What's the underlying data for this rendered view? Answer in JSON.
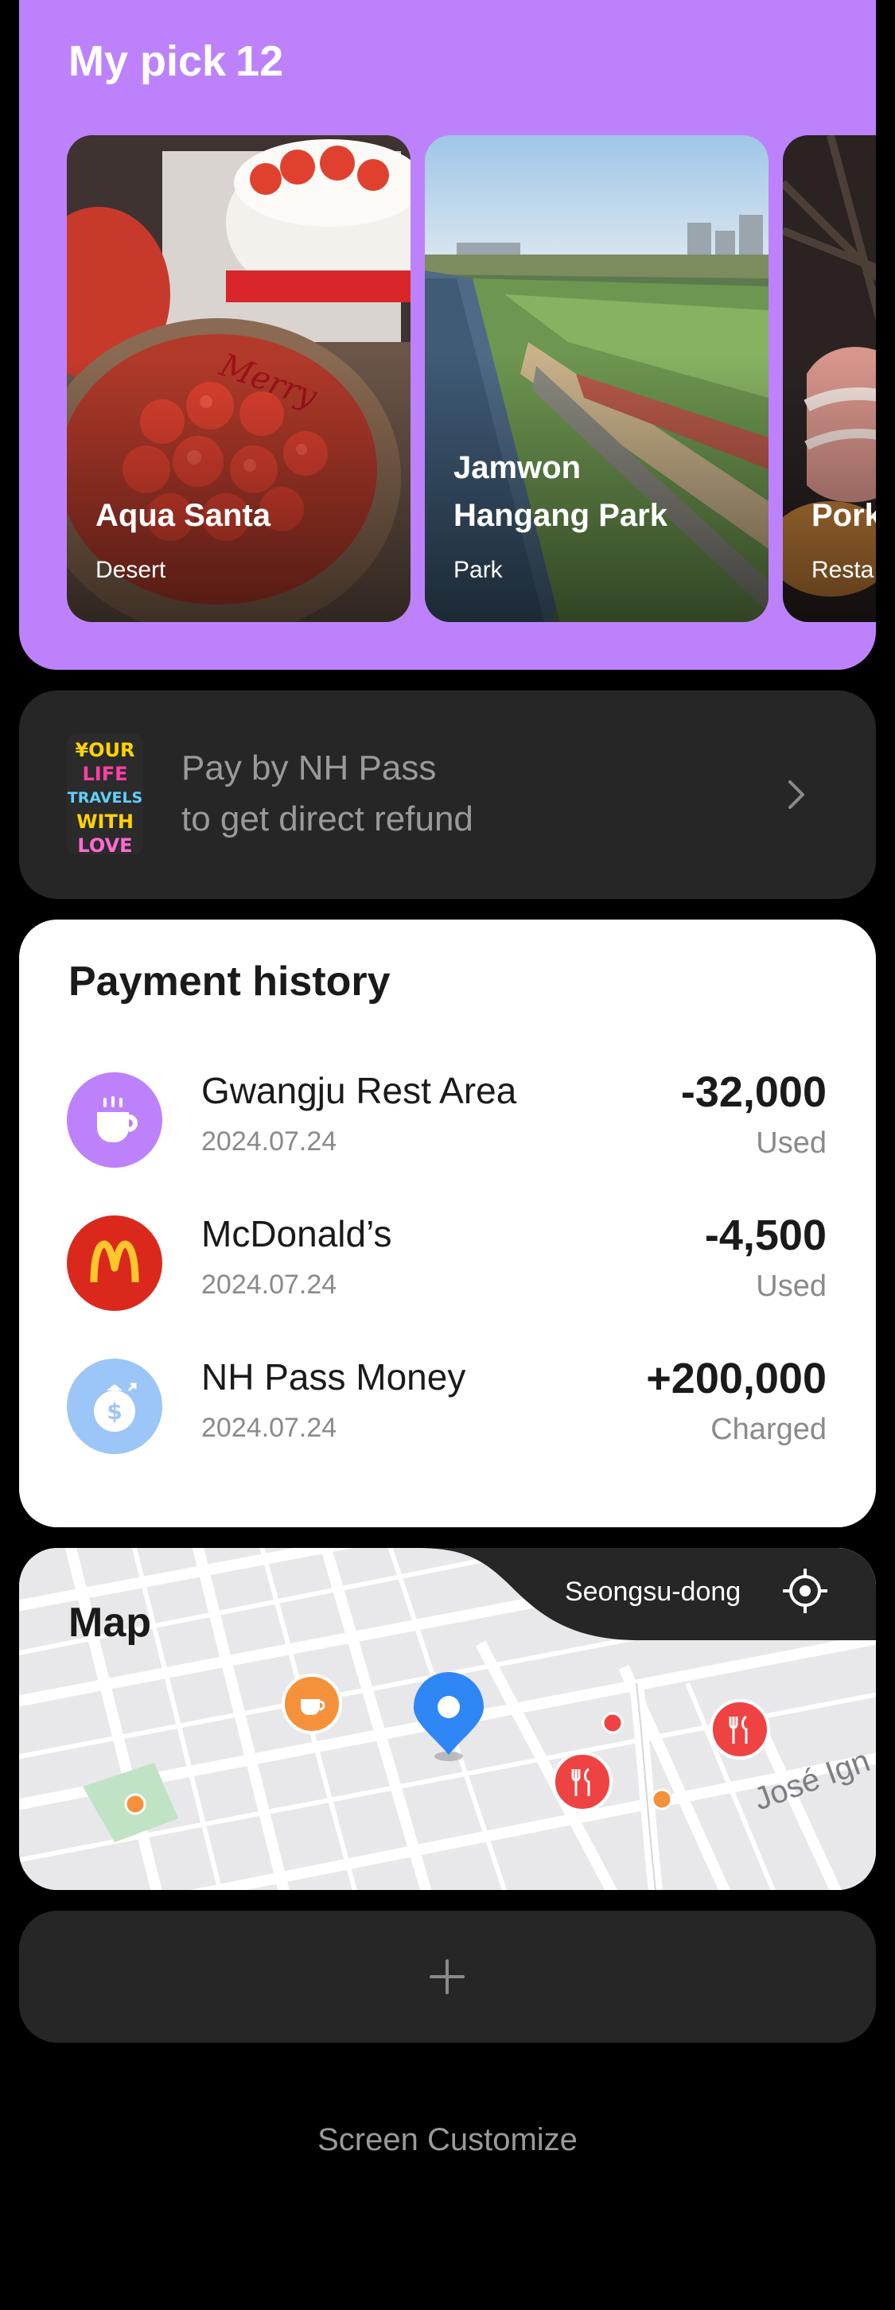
{
  "my_pick": {
    "title": "My pick",
    "count": "12",
    "cards": [
      {
        "name": "Aqua Santa",
        "category": "Desert",
        "image": "strawberry-cake-photo"
      },
      {
        "name": "Jamwon\nHangang Park",
        "category": "Park",
        "image": "river-park-photo"
      },
      {
        "name": "Pork",
        "category": "Resta",
        "image": "pork-meat-photo"
      }
    ]
  },
  "nh_banner": {
    "card_lines": [
      "¥OUR",
      "LIFE",
      "TRAVELS",
      "WITH",
      "LOVE"
    ],
    "line1": "Pay by NH Pass",
    "line2": "to get direct refund"
  },
  "payment_history": {
    "title": "Payment history",
    "items": [
      {
        "name": "Gwangju Rest Area",
        "date": "2024.07.24",
        "amount": "-32,000",
        "status": "Used",
        "icon": "coffee-cup-icon",
        "icon_color": "#bd82fb"
      },
      {
        "name": "McDonald’s",
        "date": "2024.07.24",
        "amount": "-4,500",
        "status": "Used",
        "icon": "mcdonalds-logo-icon",
        "icon_color": "#da291c"
      },
      {
        "name": "NH Pass Money",
        "date": "2024.07.24",
        "amount": "+200,000",
        "status": "Charged",
        "icon": "money-bag-icon",
        "icon_color": "#9cc5f8"
      }
    ]
  },
  "map": {
    "title": "Map",
    "location": "Seongsu-dong",
    "street_label": "José Ign",
    "pins": [
      "cafe-pin",
      "current-location-pin",
      "restaurant-pin",
      "restaurant-pin",
      "small-red-dot",
      "small-orange-dot",
      "small-orange-dot"
    ]
  },
  "add_widget": {
    "icon": "plus-icon"
  },
  "footer": {
    "customize_label": "Screen Customize"
  },
  "colors": {
    "accent": "#bd82fb",
    "card_dark": "#262626",
    "background": "#000000"
  }
}
